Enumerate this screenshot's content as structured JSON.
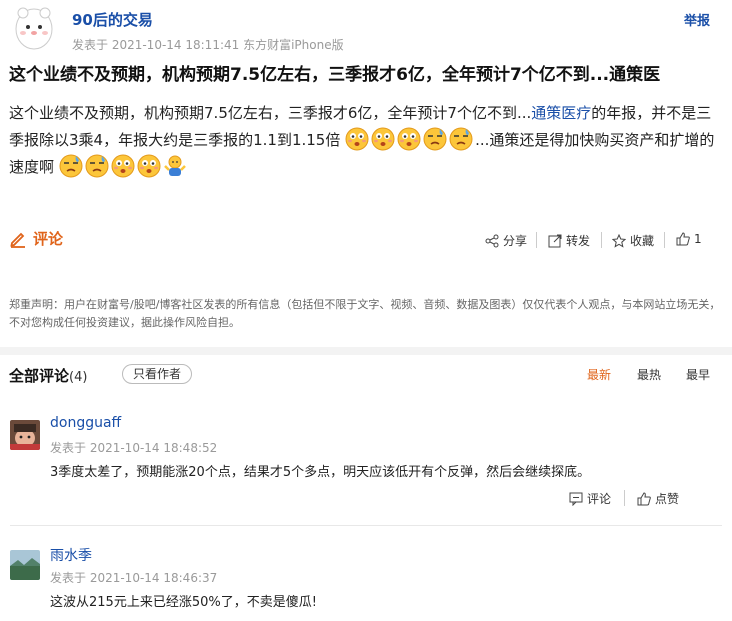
{
  "post": {
    "author": "90后的交易",
    "meta": "发表于 2021-10-14 18:11:41 东方财富iPhone版",
    "report_label": "举报",
    "title": "这个业绩不及预期，机构预期7.5亿左右，三季报才6亿，全年预计7个亿不到...通策医",
    "body_part1": "这个业绩不及预期，机构预期7.5亿左右，三季报才6亿，全年预计7个亿不到...",
    "body_link": "通策医疗",
    "body_part2": "的年报，并不是三季报除以3乘4，年报大约是三季报的1.1到1.15倍",
    "body_part3": "...通策还是得加快购买资产和扩增的速度啊"
  },
  "actions": {
    "comment_label": "评论",
    "share_label": "分享",
    "repost_label": "转发",
    "favorite_label": "收藏",
    "like_count": "1"
  },
  "disclaimer": "郑重声明：用户在财富号/股吧/博客社区发表的所有信息（包括但不限于文字、视频、音频、数据及图表）仅仅代表个人观点，与本网站立场无关，不对您构成任何投资建议，据此操作风险自担。",
  "comments_header": {
    "title": "全部评论",
    "count": "(4)",
    "only_author": "只看作者",
    "sort_latest": "最新",
    "sort_hot": "最热",
    "sort_earliest": "最早"
  },
  "comments": [
    {
      "name": "dongguaff",
      "meta": "发表于 2021-10-14 18:48:52",
      "text": "3季度太差了，预期能涨20个点，结果才5个多点，明天应该低开有个反弹，然后会继续探底。",
      "reply_label": "评论",
      "like_label": "点赞"
    },
    {
      "name": "雨水季",
      "meta": "发表于 2021-10-14 18:46:37",
      "text": "这波从215元上来已经涨50%了，不卖是傻瓜!"
    }
  ],
  "colors": {
    "link_blue": "#1a4fa8",
    "accent_orange": "#e0641b"
  }
}
